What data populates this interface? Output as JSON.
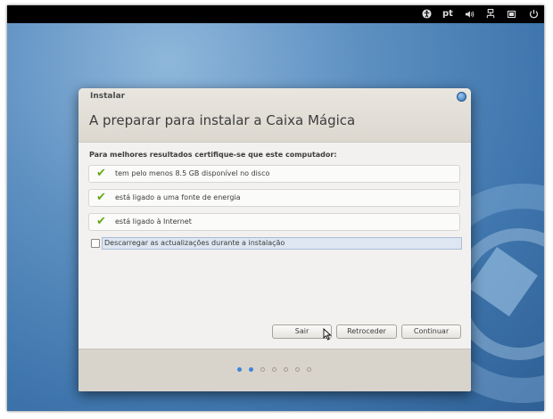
{
  "topbar": {
    "accessibility_icon": "accessibility-icon",
    "language": "pt",
    "volume_icon": "volume-icon",
    "network_icon": "network-icon",
    "battery_icon": "battery-icon",
    "power_icon": "power-icon"
  },
  "window": {
    "title": "Instalar",
    "heading": "A preparar para instalar a Caixa Mágica",
    "intro": "Para melhores resultados certifique-se que este computador:",
    "requirements": [
      {
        "label": "tem pelo menos 8.5 GB disponível no disco",
        "met": true
      },
      {
        "label": "está ligado a uma fonte de energia",
        "met": true
      },
      {
        "label": "está ligado à Internet",
        "met": true
      }
    ],
    "download_updates": {
      "label": "Descarregar as actualizações durante a instalação",
      "checked": false
    },
    "buttons": {
      "quit": "Sair",
      "back": "Retroceder",
      "continue": "Continuar"
    },
    "progress": {
      "current_step": 2,
      "total_steps": 7
    }
  },
  "colors": {
    "accent": "#3d86d6",
    "check": "#6aa51c",
    "desktop": "#4f84ba"
  }
}
